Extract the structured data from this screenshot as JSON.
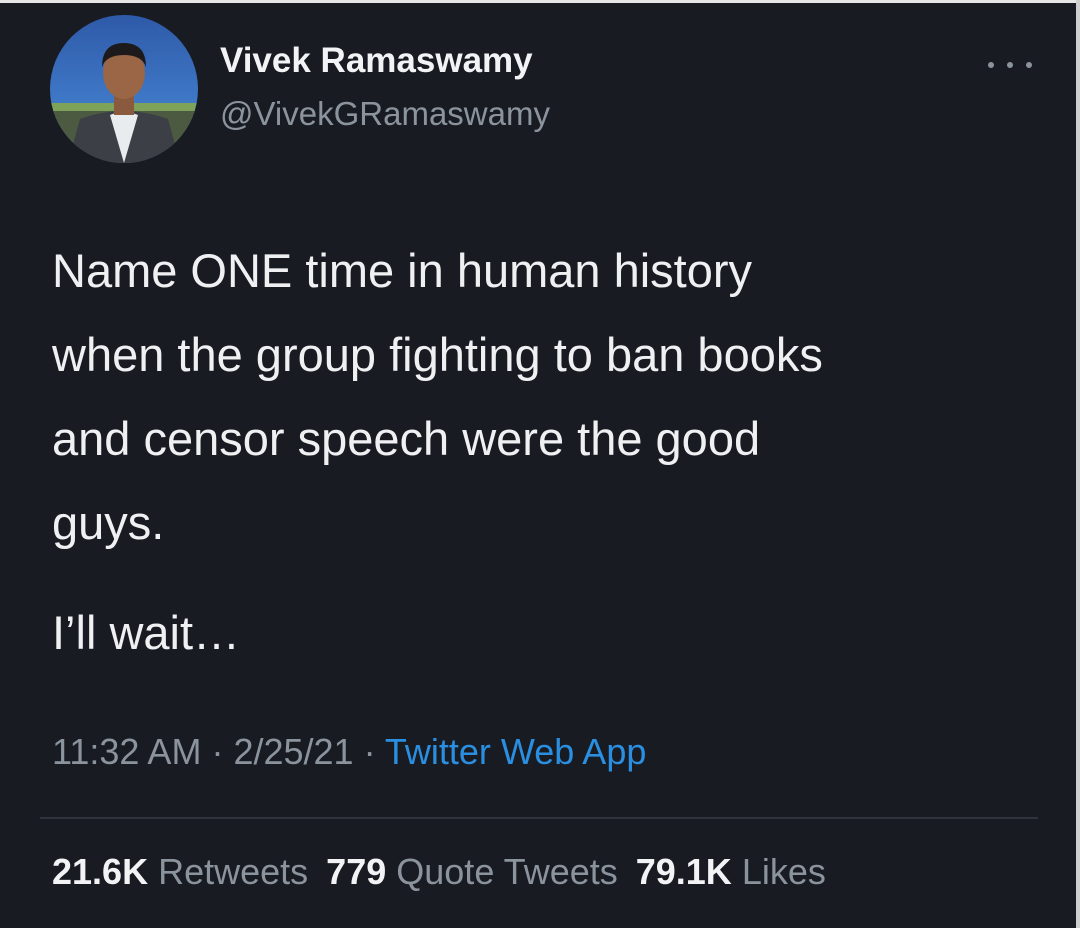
{
  "author": {
    "display_name": "Vivek Ramaswamy",
    "handle": "@VivekGRamaswamy"
  },
  "tweet": {
    "text": "Name ONE time in human history\nwhen the group fighting to ban books\nand censor speech were the good\nguys.",
    "text2": "I’ll wait…"
  },
  "meta": {
    "time": "11:32 AM",
    "sep1": " · ",
    "date": "2/25/21",
    "sep2": " · ",
    "source": "Twitter Web App"
  },
  "stats": {
    "retweets_count": "21.6K",
    "retweets_label": "Retweets",
    "quotes_count": "779",
    "quotes_label": "Quote Tweets",
    "likes_count": "79.1K",
    "likes_label": "Likes"
  },
  "icons": {
    "more": "more-horizontal-icon"
  },
  "colors": {
    "background": "#191b23",
    "text": "#eef0f2",
    "secondary": "#8b949d",
    "link": "#2a8fe0"
  }
}
